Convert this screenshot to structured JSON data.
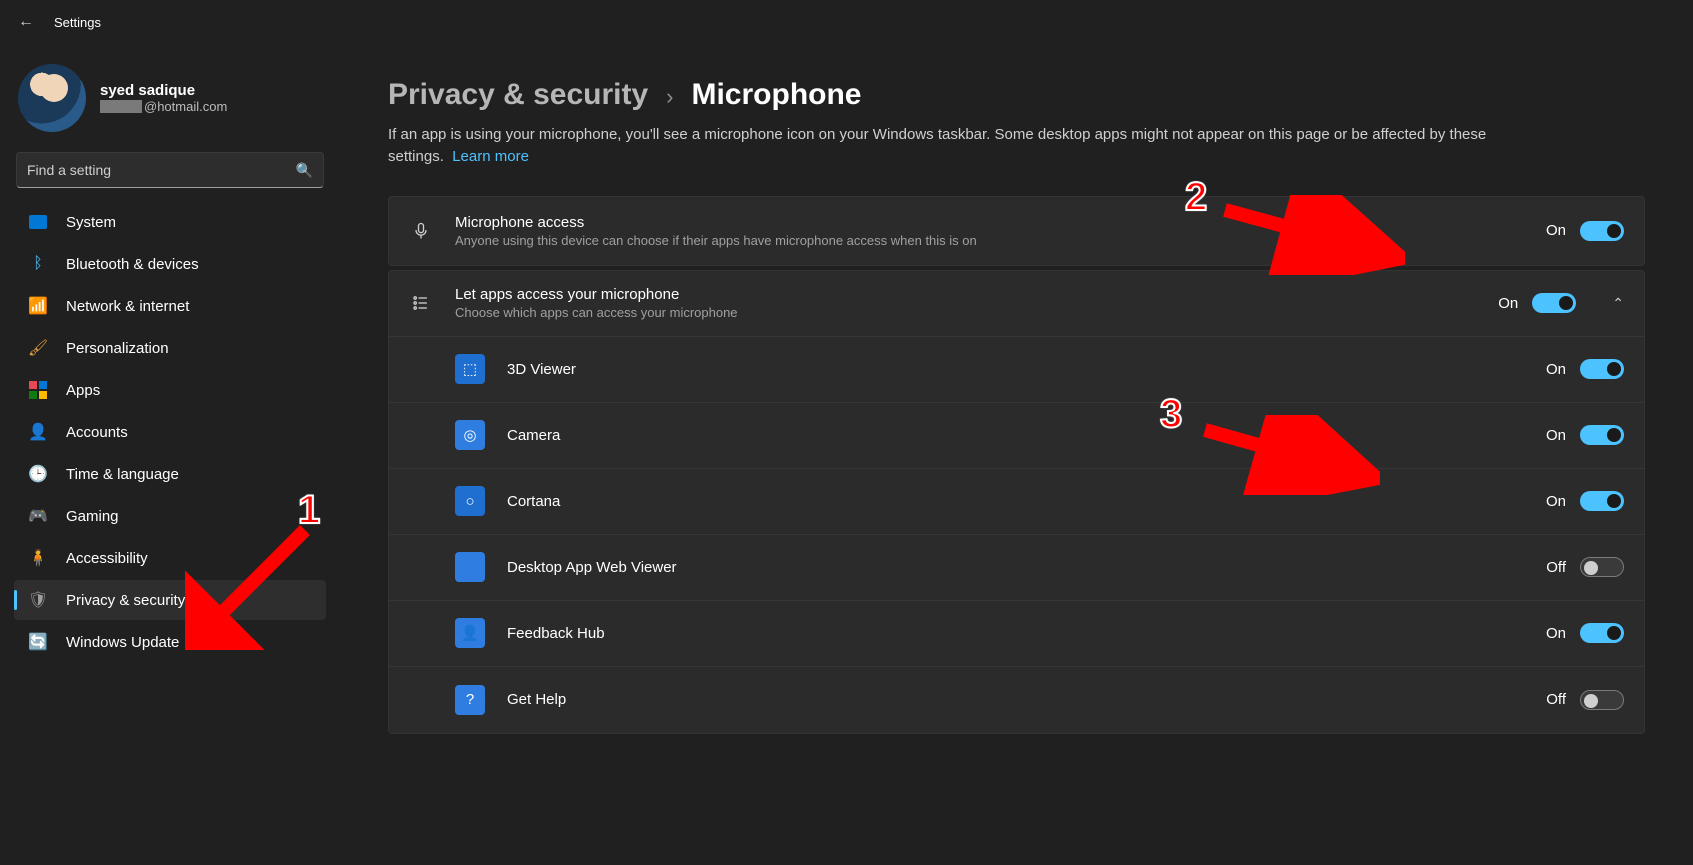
{
  "app": {
    "title": "Settings"
  },
  "user": {
    "name": "syed sadique",
    "email_suffix": "@hotmail.com"
  },
  "search": {
    "placeholder": "Find a setting"
  },
  "nav": {
    "system": "System",
    "bluetooth": "Bluetooth & devices",
    "network": "Network & internet",
    "personalization": "Personalization",
    "apps": "Apps",
    "accounts": "Accounts",
    "time": "Time & language",
    "gaming": "Gaming",
    "accessibility": "Accessibility",
    "privacy": "Privacy & security",
    "wu": "Windows Update"
  },
  "breadcrumb": {
    "parent": "Privacy & security",
    "current": "Microphone"
  },
  "subtext": "If an app is using your microphone, you'll see a microphone icon on your Windows taskbar. Some desktop apps might not appear on this page or be affected by these settings.",
  "learn_more": "Learn more",
  "cards": {
    "mic_access": {
      "title": "Microphone access",
      "sub": "Anyone using this device can choose if their apps have microphone access when this is on",
      "state": "On"
    },
    "let_apps": {
      "title": "Let apps access your microphone",
      "sub": "Choose which apps can access your microphone",
      "state": "On"
    }
  },
  "apps": [
    {
      "name": "3D Viewer",
      "state": "On",
      "color": "#1f6fd0",
      "glyph": "⬚"
    },
    {
      "name": "Camera",
      "state": "On",
      "color": "#2f7de0",
      "glyph": "◎"
    },
    {
      "name": "Cortana",
      "state": "On",
      "color": "#1f6fd0",
      "glyph": "○"
    },
    {
      "name": "Desktop App Web Viewer",
      "state": "Off",
      "color": "#2f7de0",
      "glyph": ""
    },
    {
      "name": "Feedback Hub",
      "state": "On",
      "color": "#2f7de0",
      "glyph": "👤"
    },
    {
      "name": "Get Help",
      "state": "Off",
      "color": "#2f7de0",
      "glyph": "?"
    }
  ],
  "annotations": {
    "n1": "1",
    "n2": "2",
    "n3": "3"
  }
}
